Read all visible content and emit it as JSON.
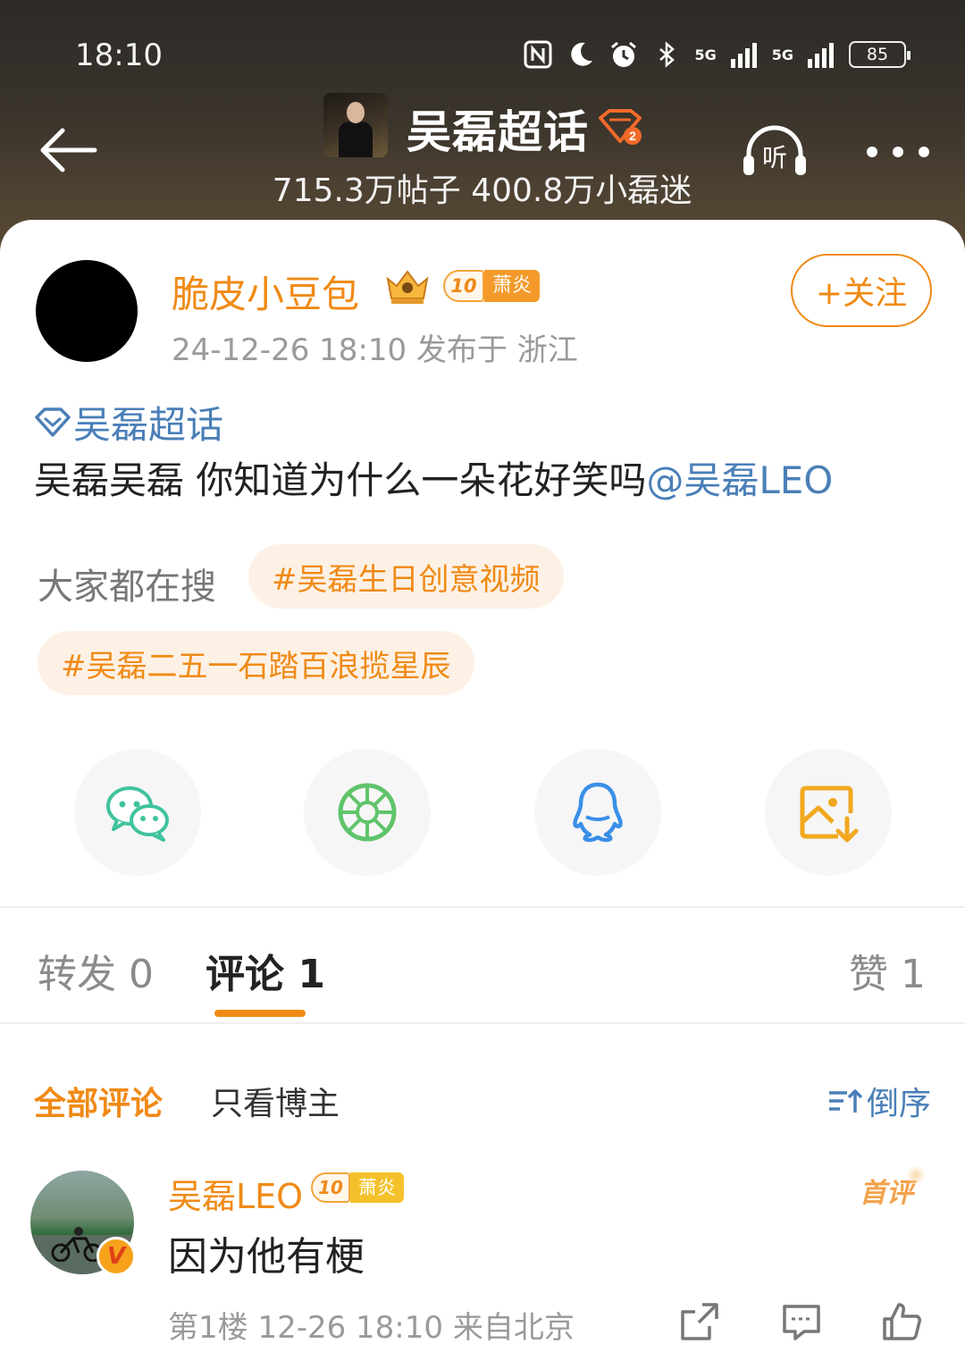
{
  "status_bar": {
    "time": "18:10",
    "icons": [
      "nfc-icon",
      "moon-icon",
      "alarm-icon",
      "bluetooth-icon",
      "signal-5g-icon",
      "signal-5g-icon"
    ],
    "net1": "5G",
    "net2": "5G",
    "battery": "85"
  },
  "header": {
    "title": "吴磊超话",
    "stats": "715.3万帖子 400.8万小磊迷",
    "listen_label": "听",
    "level_mark": "2"
  },
  "post": {
    "author": "脆皮小豆包",
    "level": "10",
    "level_name": "萧炎",
    "meta": "24-12-26 18:10  发布于 浙江",
    "follow_label": "+关注",
    "topic": "吴磊超话",
    "text": "吴磊吴磊 你知道为什么一朵花好笑吗",
    "mention": "@吴磊LEO"
  },
  "trending": {
    "label": "大家都在搜",
    "tags": [
      "#吴磊生日创意视频",
      "#吴磊二五一石踏百浪揽星辰"
    ]
  },
  "share": {
    "items": [
      "wechat-icon",
      "moments-icon",
      "qq-icon",
      "save-image-icon"
    ]
  },
  "tabs": {
    "repost": "转发 0",
    "comments": "评论 1",
    "likes": "赞 1"
  },
  "filter": {
    "all": "全部评论",
    "op_only": "只看博主",
    "sort": "倒序"
  },
  "comment": {
    "author": "吴磊LEO",
    "level": "10",
    "level_name": "萧炎",
    "badge": "首评",
    "text": "因为他有梗",
    "meta": "第1楼  12-26 18:10  来自北京"
  },
  "colors": {
    "accent": "#f08a16",
    "link": "#4a7fb8"
  }
}
